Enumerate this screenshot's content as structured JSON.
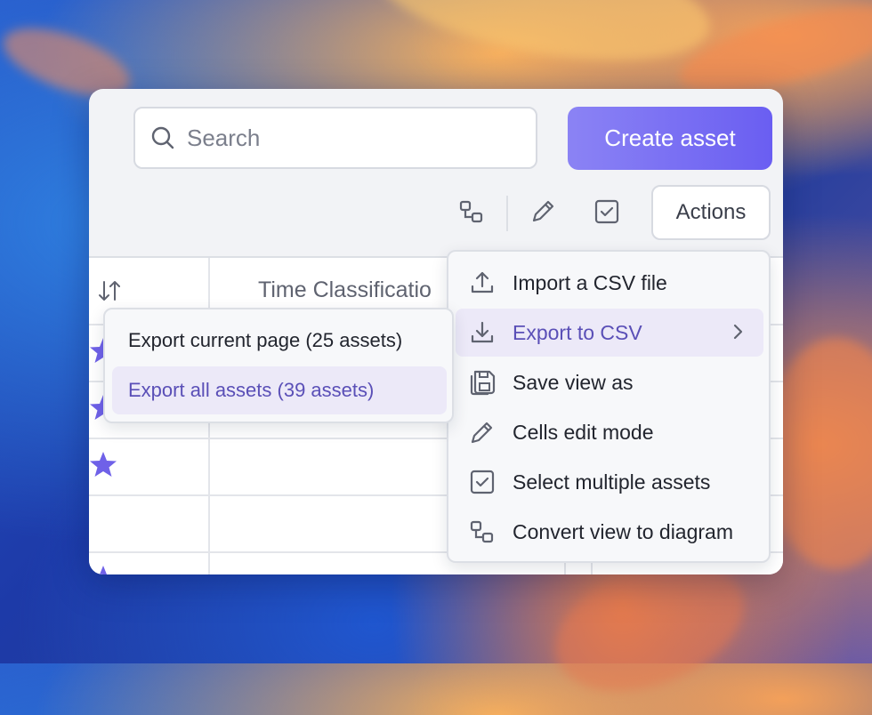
{
  "search": {
    "placeholder": "Search"
  },
  "header": {
    "create_label": "Create asset"
  },
  "toolbar": {
    "actions_label": "Actions"
  },
  "table": {
    "column_header": "Time Classificatio"
  },
  "actions_menu": {
    "items": [
      {
        "label": "Import a CSV file",
        "icon": "upload-icon"
      },
      {
        "label": "Export to CSV",
        "icon": "download-icon",
        "active": true
      },
      {
        "label": "Save view as",
        "icon": "save-icon"
      },
      {
        "label": "Cells edit mode",
        "icon": "pencil-icon"
      },
      {
        "label": "Select multiple assets",
        "icon": "checkbox-icon"
      },
      {
        "label": "Convert view to diagram",
        "icon": "diagram-icon"
      }
    ]
  },
  "export_submenu": {
    "items": [
      {
        "label": "Export current page (25 assets)"
      },
      {
        "label": "Export all assets (39 assets)",
        "active": true
      }
    ]
  },
  "colors": {
    "accent": "#6a5ef2",
    "active_bg": "#ece9f8",
    "active_text": "#5a4fb7",
    "star": "#6f61e8"
  }
}
